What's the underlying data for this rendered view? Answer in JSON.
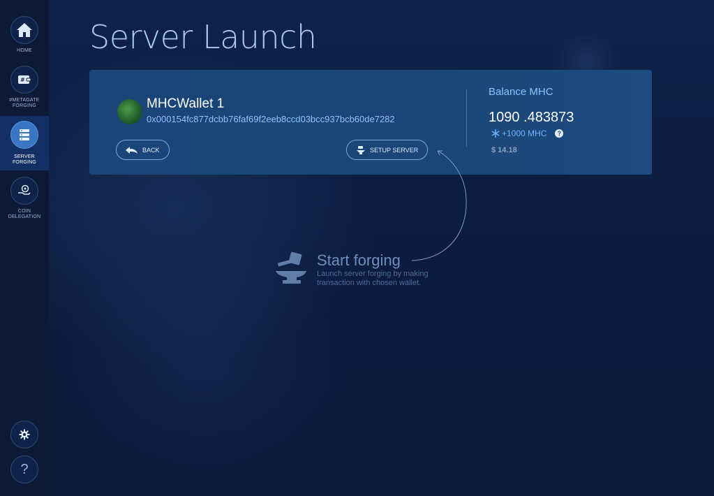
{
  "sidebar": {
    "items": [
      {
        "label": "HOME",
        "icon": "home-icon"
      },
      {
        "label": "#METAGATE FORGING",
        "icon": "wallet-tag-icon"
      },
      {
        "label": "SERVER FORGING",
        "icon": "server-icon",
        "active": true
      },
      {
        "label": "COIN DELEGATION",
        "icon": "coin-hand-icon"
      }
    ],
    "settings_icon": "gear-icon",
    "help_label": "?"
  },
  "page": {
    "title": "Server Launch"
  },
  "wallet": {
    "name": "MHCWallet 1",
    "address": "0x000154fc877dcbb76faf69f2eeb8ccd03bcc937bcb60de7282"
  },
  "buttons": {
    "back": "BACK",
    "setup": "SETUP SERVER"
  },
  "balance": {
    "title": "Balance MHC",
    "value": "1090 .483873",
    "bonus": "+1000 MHC",
    "usd": "$ 14.18"
  },
  "empty_state": {
    "title": "Start forging",
    "description": "Launch server forging by making transaction with chosen wallet."
  },
  "colors": {
    "accent": "#8cc2ff",
    "background": "#0b1b3a",
    "card": "#1b4578"
  }
}
